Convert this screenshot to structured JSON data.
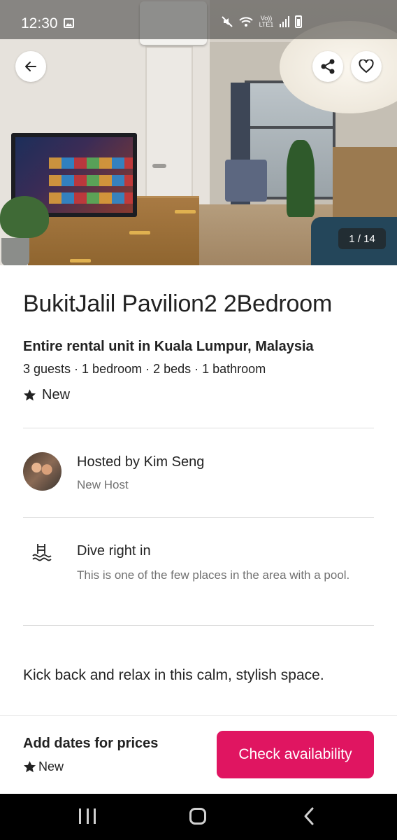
{
  "status_bar": {
    "time": "12:30",
    "icons": [
      "gallery-icon",
      "mute-icon",
      "wifi-icon",
      "volte-icon",
      "signal-icon",
      "battery-icon"
    ],
    "network_label": "Vo)) LTE1"
  },
  "photo": {
    "counter": "1 / 14",
    "icons": [
      "back-arrow-icon",
      "share-icon",
      "heart-icon"
    ]
  },
  "listing": {
    "title": "BukitJalil Pavilion2 2Bedroom",
    "subtitle": "Entire rental unit in Kuala Lumpur, Malaysia",
    "specs": "3 guests · 1 bedroom · 2 beds · 1 bathroom",
    "rating_label": "New"
  },
  "host": {
    "title": "Hosted by Kim Seng",
    "subtitle": "New Host"
  },
  "feature": {
    "icon": "pool-icon",
    "title": "Dive right in",
    "description": "This is one of the few places in the area with a pool."
  },
  "description": "Kick back and relax in this calm, stylish space.",
  "footer": {
    "price_label": "Add dates for prices",
    "rating_label": "New",
    "cta_label": "Check availability"
  },
  "colors": {
    "accent": "#e01561",
    "text": "#222222",
    "muted": "#717171",
    "divider": "#dddddd"
  }
}
